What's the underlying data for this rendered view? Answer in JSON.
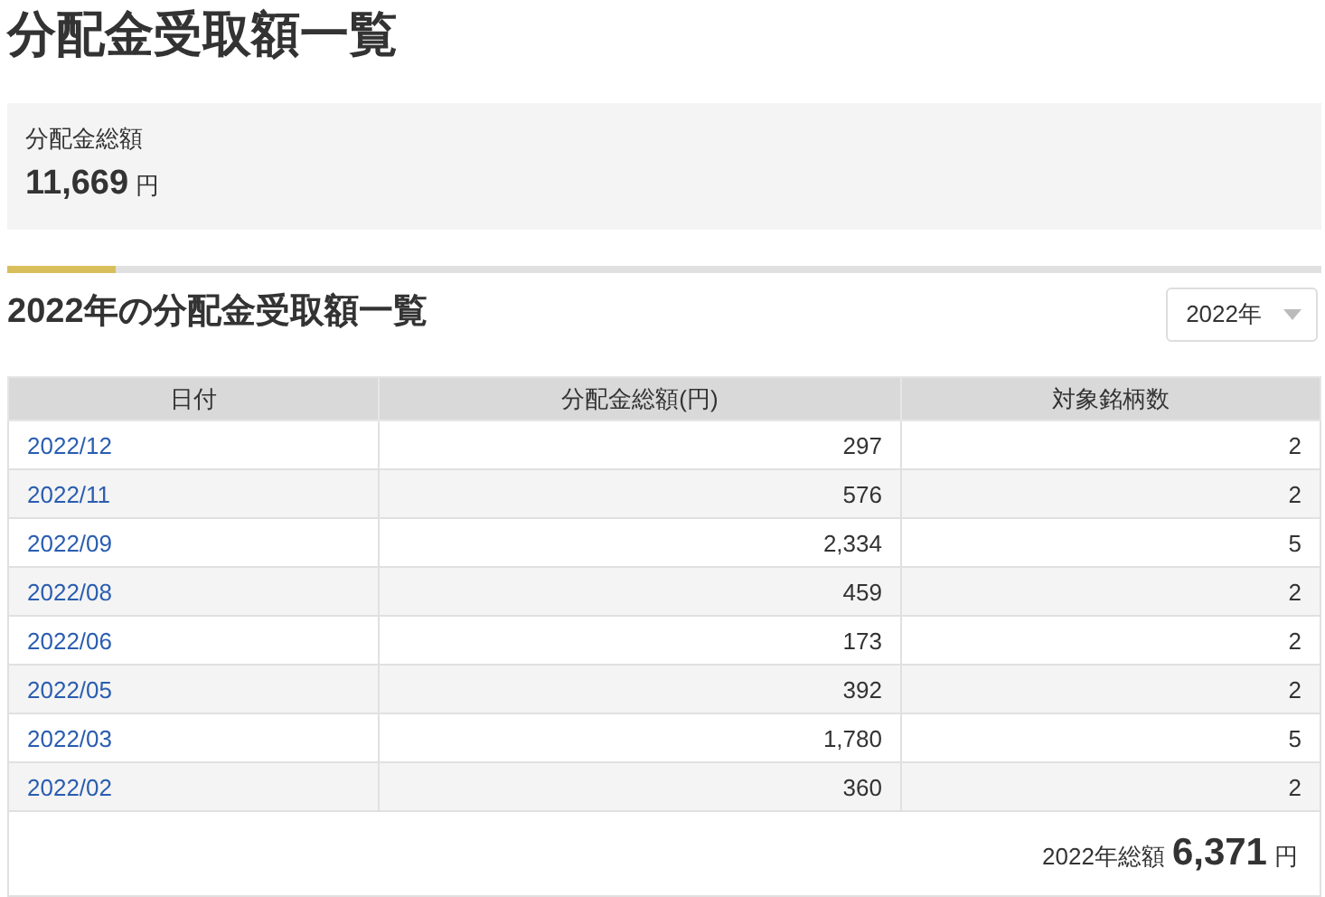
{
  "title": "分配金受取額一覧",
  "summary": {
    "label": "分配金総額",
    "amount": "11,669",
    "unit": "円"
  },
  "section": {
    "title": "2022年の分配金受取額一覧",
    "year_select": {
      "value": "2022年"
    }
  },
  "table": {
    "columns": [
      "日付",
      "分配金総額(円)",
      "対象銘柄数"
    ],
    "rows": [
      {
        "date": "2022/12",
        "amount": "297",
        "count": "2"
      },
      {
        "date": "2022/11",
        "amount": "576",
        "count": "2"
      },
      {
        "date": "2022/09",
        "amount": "2,334",
        "count": "5"
      },
      {
        "date": "2022/08",
        "amount": "459",
        "count": "2"
      },
      {
        "date": "2022/06",
        "amount": "173",
        "count": "2"
      },
      {
        "date": "2022/05",
        "amount": "392",
        "count": "2"
      },
      {
        "date": "2022/03",
        "amount": "1,780",
        "count": "5"
      },
      {
        "date": "2022/02",
        "amount": "360",
        "count": "2"
      }
    ],
    "footer": {
      "label": "2022年総額",
      "amount": "6,371",
      "unit": "円"
    }
  }
}
